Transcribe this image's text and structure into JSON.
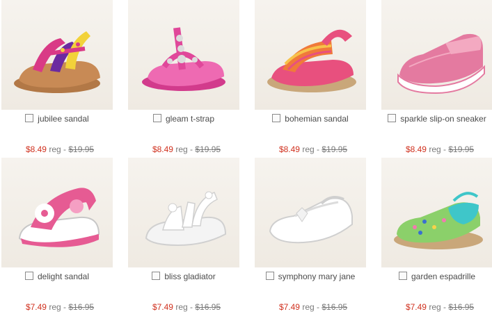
{
  "labels": {
    "reg": "reg - "
  },
  "products": [
    {
      "name": "jubilee sandal",
      "sale_price": "$8.49",
      "original_price": "$19.95",
      "colors": [
        "#d93a86",
        "#6b2aa0",
        "#f2d23a",
        "#b07a45"
      ]
    },
    {
      "name": "gleam t-strap",
      "sale_price": "$8.49",
      "original_price": "$19.95",
      "colors": [
        "#e0479a",
        "#f07bb8",
        "#d8d8d8"
      ]
    },
    {
      "name": "bohemian sandal",
      "sale_price": "$8.49",
      "original_price": "$19.95",
      "colors": [
        "#e8507e",
        "#f07a3a",
        "#c9a77a"
      ]
    },
    {
      "name": "sparkle slip-on sneaker",
      "sale_price": "$8.49",
      "original_price": "$19.95",
      "colors": [
        "#e47aa0",
        "#f3a9c1",
        "#ffffff"
      ]
    },
    {
      "name": "delight sandal",
      "sale_price": "$7.49",
      "original_price": "$16.95",
      "colors": [
        "#e65b93",
        "#ffffff",
        "#c7c7c7"
      ]
    },
    {
      "name": "bliss gladiator",
      "sale_price": "$7.49",
      "original_price": "$16.95",
      "colors": [
        "#ffffff",
        "#d9d9d9"
      ]
    },
    {
      "name": "symphony mary jane",
      "sale_price": "$7.49",
      "original_price": "$16.95",
      "colors": [
        "#ffffff",
        "#dcdcdc"
      ]
    },
    {
      "name": "garden espadrille",
      "sale_price": "$7.49",
      "original_price": "$16.95",
      "colors": [
        "#3fc6c9",
        "#8bd06a",
        "#c9a77a"
      ]
    }
  ]
}
